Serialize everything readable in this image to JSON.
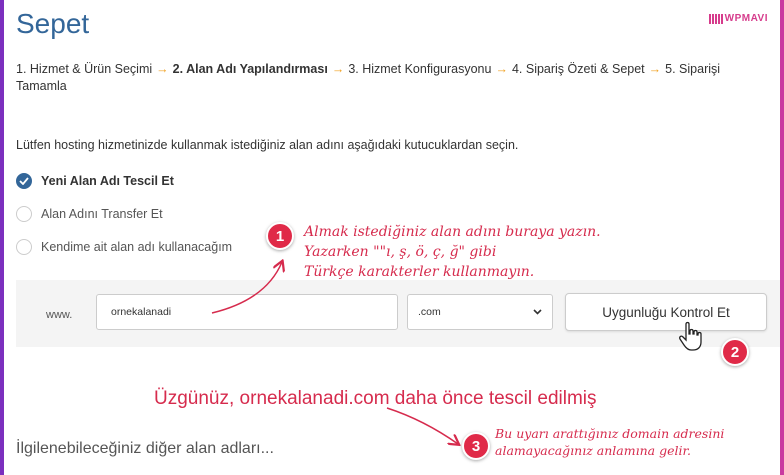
{
  "page": {
    "title": "Sepet",
    "logo_text": "WPMAVI",
    "accent_color": "#336699",
    "annotation_color": "#d62b4d"
  },
  "steps": [
    {
      "label": "1. Hizmet & Ürün Seçimi",
      "active": false
    },
    {
      "label": "2. Alan Adı Yapılandırması",
      "active": true
    },
    {
      "label": "3. Hizmet Konfigurasyonu",
      "active": false
    },
    {
      "label": "4. Sipariş Özeti & Sepet",
      "active": false
    },
    {
      "label": "5. Siparişi Tamamla",
      "active": false
    }
  ],
  "step_separator": "→",
  "intro_text": "Lütfen hosting hizmetinizde kullanmak istediğiniz alan adını aşağıdaki kutucuklardan seçin.",
  "options": [
    {
      "label": "Yeni Alan Adı Tescil Et",
      "checked": true
    },
    {
      "label": "Alan Adını Transfer Et",
      "checked": false
    },
    {
      "label": "Kendime ait alan adı kullanacağım",
      "checked": false
    }
  ],
  "search": {
    "prefix": "www.",
    "domain_value": "ornekalanadi",
    "tld_selected": ".com",
    "check_button": "Uygunluğu Kontrol Et"
  },
  "annotations": {
    "note1": {
      "number": "1",
      "lines": [
        "Almak istediğiniz alan adını buraya yazın.",
        "Yazarken \"\"ı, ş, ö, ç, ğ\" gibi",
        "Türkçe karakterler kullanmayın."
      ]
    },
    "note2": {
      "number": "2"
    },
    "note3": {
      "number": "3",
      "lines": [
        "Bu uyarı arattığınız domain adresini",
        "alamayacağınız anlamına gelir."
      ]
    }
  },
  "error_message": "Üzgünüz, ornekalanadi.com daha önce tescil edilmiş",
  "others_heading": "İlgilenebileceğiniz diğer alan adları..."
}
